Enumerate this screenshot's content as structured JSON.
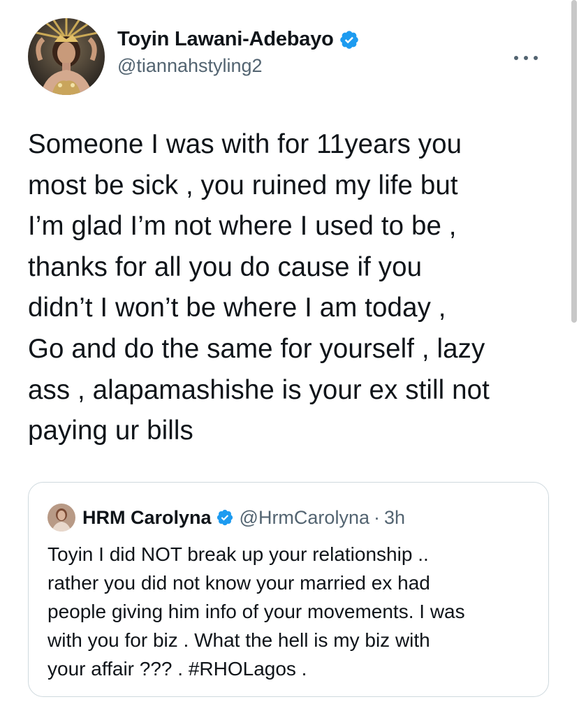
{
  "author": {
    "display_name": "Toyin Lawani-Adebayo",
    "handle": "@tiannahstyling2",
    "verified": true,
    "avatar_icon": "profile-photo"
  },
  "more_icon": "more-options-icon",
  "tweet": {
    "text": "Someone I was with for 11years you\nmost be sick , you ruined my life but\nI’m glad I’m not where I used to be ,\nthanks for all you do cause if you\ndidn’t I won’t be where I am today ,\nGo and do the same for yourself , lazy\nass , alapamashishe is your ex still not\npaying ur bills"
  },
  "quoted_tweet": {
    "display_name": "HRM Carolyna",
    "handle": "@HrmCarolyna",
    "separator": "·",
    "time": "3h",
    "verified": true,
    "text": "Toyin I did NOT break up your relationship ..\nrather you did not know your married ex had\npeople giving him info of your movements. I was\nwith you for biz . What the hell is my biz with\nyour affair ??? . #RHOLagos ."
  },
  "colors": {
    "verified_blue": "#1d9bf0",
    "text_primary": "#0f1419",
    "text_secondary": "#536471",
    "border": "#cfd9de"
  }
}
